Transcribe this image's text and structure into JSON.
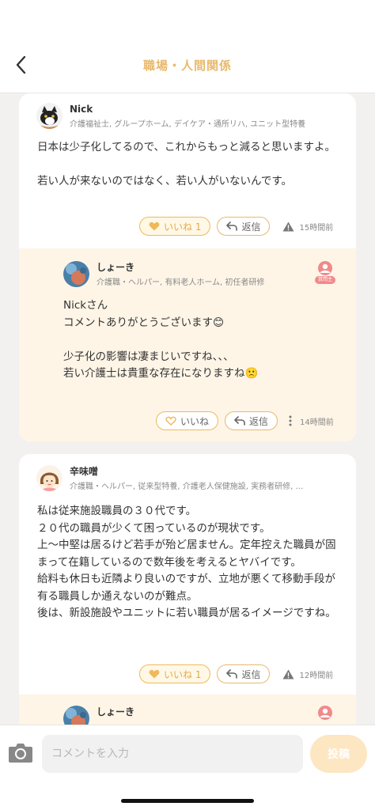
{
  "header": {
    "title": "職場・人間関係"
  },
  "posts": [
    {
      "author": "Nick",
      "tags": "介護福祉士, グループホーム, デイケア・通所リハ, ユニット型特養",
      "body": "日本は少子化してるので、これからもっと減ると思いますよ。\n\n若い人が来ないのではなく、若い人がいないんです。",
      "like_label": "いいね 1",
      "reply_label": "返信",
      "time": "15時間前",
      "reply": {
        "author": "しょーき",
        "tags": "介護職・ヘルパー, 有料老人ホーム, 初任者研修",
        "badge": "質問主",
        "body": "Nickさん\nコメントありがとうございます😊\n\n少子化の影響は凄まじいですね、、、\n若い介護士は貴重な存在になりますね🙁",
        "like_label": "いいね",
        "reply_label": "返信",
        "time": "14時間前"
      }
    },
    {
      "author": "辛味噌",
      "tags": "介護職・ヘルパー, 従来型特養, 介護老人保健施設, 実務者研修, …",
      "body": "私は従来施設職員の３０代です。\n２０代の職員が少くて困っているのが現状です。\n上〜中堅は居るけど若手が殆ど居ません。定年控えた職員が固まって在籍しているので数年後を考えるとヤバイです。\n給料も休日も近隣より良いのですが、立地が悪くて移動手段が有る職員しか通えないのが難点。\n後は、新設施設やユニットに若い職員が居るイメージですね。",
      "like_label": "いいね 1",
      "reply_label": "返信",
      "time": "12時間前",
      "reply": {
        "author": "しょーき"
      }
    }
  ],
  "composer": {
    "placeholder": "コメントを入力",
    "post_label": "投稿"
  },
  "colors": {
    "accent": "#e8b96e",
    "reply_bg": "#fef5e7",
    "badge": "#f08a8a"
  }
}
